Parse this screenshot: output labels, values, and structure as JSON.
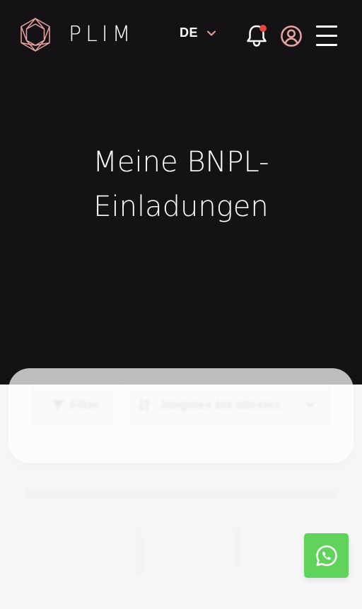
{
  "header": {
    "brand": "PLIM",
    "language": {
      "selected": "DE",
      "icon": "chevron-down-icon"
    },
    "icons": {
      "logo": "hexagon-logo-icon",
      "notifications": "bell-icon",
      "account": "user-circle-icon",
      "menu": "hamburger-menu-icon"
    },
    "has_notification": true
  },
  "page": {
    "title_line1": "Meine BNPL-",
    "title_line2": "Einladungen"
  },
  "controls": {
    "filter_label": "Filter",
    "filter_icon": "funnel-icon",
    "sort_selected": "Jüngstes bis ältestes",
    "sort_icon": "sort-arrows-icon",
    "sort_chevron": "chevron-down-icon"
  },
  "fab": {
    "icon": "whatsapp-icon"
  },
  "colors": {
    "hero_background": "#141215",
    "page_background": "#f6f6f8",
    "accent": "#e9a3a0",
    "notification_dot": "#e8463f",
    "whatsapp": "#5fd35b"
  }
}
